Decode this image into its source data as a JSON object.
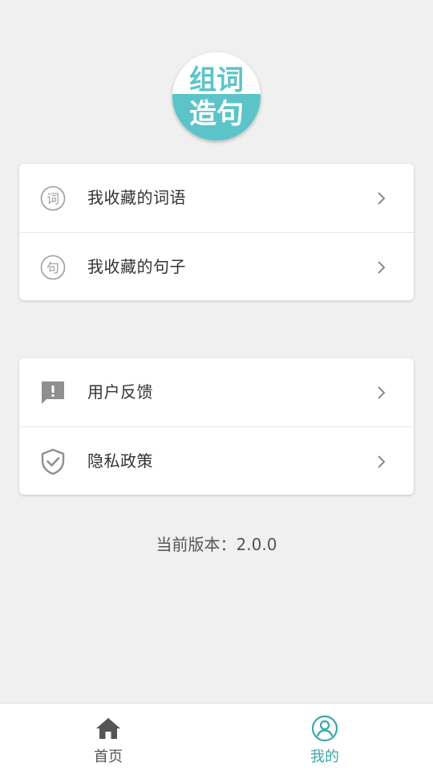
{
  "logo": {
    "line1": "组词",
    "line2": "造句",
    "top_color": "#ffffff",
    "bottom_color": "#5cc4c9",
    "line1_color": "#5cc4c9",
    "line2_color": "#ffffff"
  },
  "menu_groups": [
    {
      "items": [
        {
          "icon": "ci-circle-icon",
          "icon_char": "词",
          "label": "我收藏的词语"
        },
        {
          "icon": "ju-circle-icon",
          "icon_char": "句",
          "label": "我收藏的句子"
        }
      ]
    },
    {
      "items": [
        {
          "icon": "feedback-icon",
          "label": "用户反馈"
        },
        {
          "icon": "shield-check-icon",
          "label": "隐私政策"
        }
      ]
    }
  ],
  "version": {
    "text": "当前版本：2.0.0"
  },
  "tabbar": {
    "tabs": [
      {
        "icon": "home-icon",
        "label": "首页",
        "active": false
      },
      {
        "icon": "user-circle-icon",
        "label": "我的",
        "active": true
      }
    ],
    "active_color": "#3aa8a8",
    "inactive_color": "#555555"
  }
}
